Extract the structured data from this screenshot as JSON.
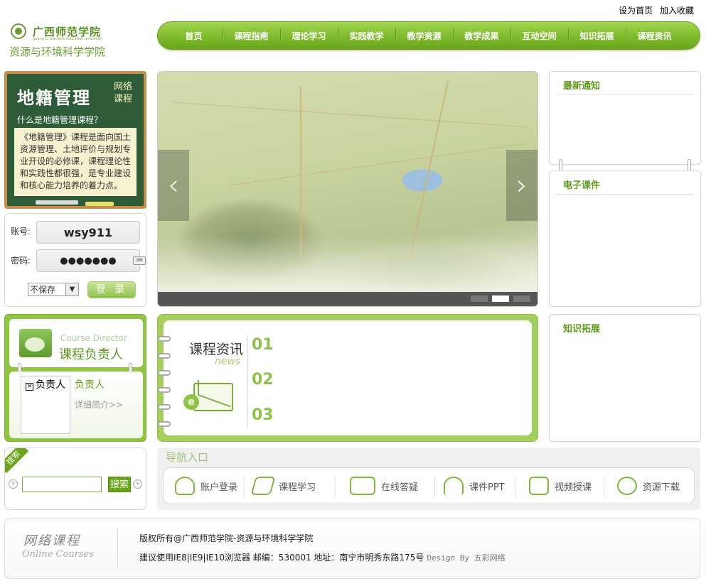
{
  "top_links": [
    "设为首页",
    "加入收藏"
  ],
  "logo": {
    "name": "广西师范学院",
    "sub": "guang xi teachers education university",
    "college": "资源与环境科学学院"
  },
  "nav": [
    "首页",
    "课程指南",
    "理论学习",
    "实践教学",
    "教学资源",
    "教学成果",
    "互动空间",
    "知识拓展",
    "课程资讯"
  ],
  "course": {
    "title": "地籍管理",
    "tag": "网络课程",
    "question": "什么是地籍管理课程？",
    "description": "《地籍管理》课程是面向国土资源管理、土地评价与规划专业开设的必修课，课程理论性和实践性都很强，是专业建设和核心能力培养的着力点。"
  },
  "login": {
    "account_label": "账号:",
    "account_value": "wsy911",
    "password_label": "密码:",
    "password_value": "●●●●●●●",
    "keyboard_icon": "keyboard-icon",
    "save_option": "不保存",
    "button": "登 录"
  },
  "slider": {
    "prev": "‹",
    "next": "›"
  },
  "right_boxes": {
    "notice": "最新通知",
    "courseware": "电子课件",
    "knowledge": "知识拓展"
  },
  "director": {
    "en": "Course Director",
    "cn": "课程负责人",
    "photo_alt": "负责人",
    "name": "负责人",
    "more": "详细简介>>"
  },
  "news": {
    "title": "课程资讯",
    "en": "news",
    "numbers": [
      "01",
      "02",
      "03"
    ]
  },
  "search": {
    "tag": "搜索",
    "button": "搜索",
    "prev": "‹",
    "next": "›"
  },
  "guide": {
    "title": "导航入口",
    "items": [
      "账户登录",
      "课程学习",
      "在线答疑",
      "课件PPT",
      "视频授课",
      "资源下载"
    ]
  },
  "footer": {
    "logo_cn": "网络课程",
    "logo_en": "Online Courses",
    "copyright": "版权所有@广西师范学院-资源与环境科学学院",
    "info": "建议使用IE8|IE9|IE10浏览器 邮编：530001 地址：南宁市明秀东路175号",
    "design": "Design By 五彩网络"
  },
  "colors": {
    "accent": "#7fbb2c",
    "title_green": "#5f9b1f",
    "board": "#2f5c38",
    "board_frame": "#c68e4c"
  }
}
